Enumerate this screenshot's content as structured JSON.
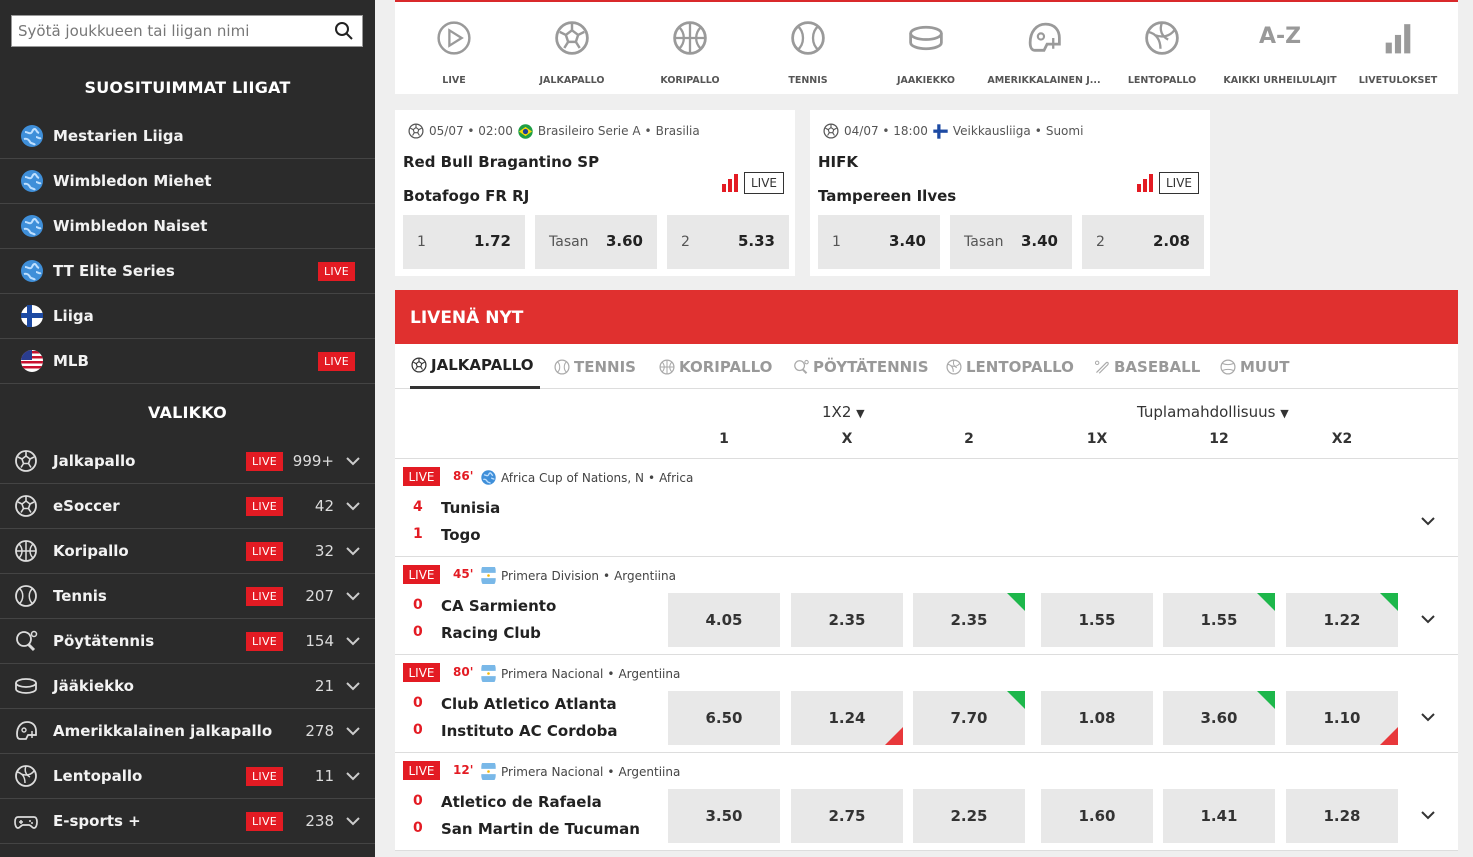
{
  "search": {
    "placeholder": "Syötä joukkueen tai liigan nimi"
  },
  "popular": {
    "title": "SUOSITUIMMAT LIIGAT",
    "items": [
      {
        "label": "Mestarien Liiga",
        "icon": "globe-icon",
        "live": ""
      },
      {
        "label": "Wimbledon Miehet",
        "icon": "globe-icon",
        "live": ""
      },
      {
        "label": "Wimbledon Naiset",
        "icon": "globe-icon",
        "live": ""
      },
      {
        "label": "TT Elite Series",
        "icon": "globe-icon",
        "live": "LIVE"
      },
      {
        "label": "Liiga",
        "icon": "finland-flag-icon",
        "live": ""
      },
      {
        "label": "MLB",
        "icon": "usa-flag-icon",
        "live": "LIVE"
      }
    ]
  },
  "menu": {
    "title": "VALIKKO",
    "items": [
      {
        "label": "Jalkapallo",
        "icon": "soccer-ball-icon",
        "live": "LIVE",
        "count": "999+"
      },
      {
        "label": "eSoccer",
        "icon": "soccer-ball-icon",
        "live": "LIVE",
        "count": "42"
      },
      {
        "label": "Koripallo",
        "icon": "basketball-icon",
        "live": "LIVE",
        "count": "32"
      },
      {
        "label": "Tennis",
        "icon": "tennis-ball-icon",
        "live": "LIVE",
        "count": "207"
      },
      {
        "label": "Pöytätennis",
        "icon": "table-tennis-icon",
        "live": "LIVE",
        "count": "154"
      },
      {
        "label": "Jääkiekko",
        "icon": "hockey-puck-icon",
        "live": "",
        "count": "21"
      },
      {
        "label": "Amerikkalainen jalkapallo",
        "icon": "football-helmet-icon",
        "live": "",
        "count": "278"
      },
      {
        "label": "Lentopallo",
        "icon": "volleyball-icon",
        "live": "LIVE",
        "count": "11"
      },
      {
        "label": "E-sports +",
        "icon": "gamepad-icon",
        "live": "LIVE",
        "count": "238"
      }
    ]
  },
  "sports": [
    {
      "label": "LIVE",
      "icon": "play-circle-icon"
    },
    {
      "label": "JALKAPALLO",
      "icon": "soccer-ball-icon"
    },
    {
      "label": "KORIPALLO",
      "icon": "basketball-icon"
    },
    {
      "label": "TENNIS",
      "icon": "tennis-ball-icon"
    },
    {
      "label": "JÄÄKIEKKO",
      "icon": "hockey-puck-icon"
    },
    {
      "label": "AMERIKKALAINEN J...",
      "icon": "football-helmet-icon"
    },
    {
      "label": "LENTOPALLO",
      "icon": "volleyball-icon"
    },
    {
      "label": "KAIKKI URHEILULAJIT",
      "icon": "az-icon"
    },
    {
      "label": "LIVETULOKSET",
      "icon": "bar-chart-icon"
    }
  ],
  "az_glyph": "A-Z",
  "cards": [
    {
      "date": "05/07 • 02:00",
      "league": "Brasileiro Serie A",
      "country": "Brasilia",
      "flag": "brazil-flag-icon",
      "team1": "Red Bull Bragantino SP",
      "team2": "Botafogo FR RJ",
      "live": "LIVE",
      "odds": [
        {
          "label": "1",
          "value": "1.72"
        },
        {
          "label": "Tasan",
          "value": "3.60"
        },
        {
          "label": "2",
          "value": "5.33"
        }
      ]
    },
    {
      "date": "04/07 • 18:00",
      "league": "Veikkausliiga",
      "country": "Suomi",
      "flag": "finland-flag-icon",
      "team1": "HIFK",
      "team2": "Tampereen Ilves",
      "live": "LIVE",
      "odds": [
        {
          "label": "1",
          "value": "3.40"
        },
        {
          "label": "Tasan",
          "value": "3.40"
        },
        {
          "label": "2",
          "value": "2.08"
        }
      ]
    }
  ],
  "live_now": {
    "title": "LIVENÄ NYT",
    "tabs": [
      {
        "label": "JALKAPALLO",
        "icon": "soccer-ball-icon",
        "active": true
      },
      {
        "label": "TENNIS",
        "icon": "tennis-ball-icon",
        "active": false
      },
      {
        "label": "KORIPALLO",
        "icon": "basketball-icon",
        "active": false
      },
      {
        "label": "PÖYTÄTENNIS",
        "icon": "table-tennis-icon",
        "active": false
      },
      {
        "label": "LENTOPALLO",
        "icon": "volleyball-icon",
        "active": false
      },
      {
        "label": "BASEBALL",
        "icon": "baseball-bat-icon",
        "active": false
      },
      {
        "label": "MUUT",
        "icon": "other-sports-icon",
        "active": false
      }
    ],
    "market1": "1X2",
    "market2": "Tuplamahdollisuus",
    "cols": [
      "1",
      "X",
      "2",
      "1X",
      "12",
      "X2"
    ],
    "matches": [
      {
        "live": "LIVE",
        "minute": "86'",
        "league": "Africa Cup of Nations, N",
        "country": "Africa",
        "flag": "globe-icon",
        "score1": "4",
        "team1": "Tunisia",
        "score2": "1",
        "team2": "Togo",
        "odds": []
      },
      {
        "live": "LIVE",
        "minute": "45'",
        "league": "Primera Division",
        "country": "Argentiina",
        "flag": "argentina-flag-icon",
        "score1": "0",
        "team1": "CA Sarmiento",
        "score2": "0",
        "team2": "Racing Club",
        "odds": [
          {
            "value": "4.05",
            "trend": ""
          },
          {
            "value": "2.35",
            "trend": ""
          },
          {
            "value": "2.35",
            "trend": "up"
          },
          {
            "value": "1.55",
            "trend": ""
          },
          {
            "value": "1.55",
            "trend": "up"
          },
          {
            "value": "1.22",
            "trend": "up"
          }
        ]
      },
      {
        "live": "LIVE",
        "minute": "80'",
        "league": "Primera Nacional",
        "country": "Argentiina",
        "flag": "argentina-flag-icon",
        "score1": "0",
        "team1": "Club Atletico Atlanta",
        "score2": "0",
        "team2": "Instituto AC Cordoba",
        "odds": [
          {
            "value": "6.50",
            "trend": ""
          },
          {
            "value": "1.24",
            "trend": "down"
          },
          {
            "value": "7.70",
            "trend": "up"
          },
          {
            "value": "1.08",
            "trend": ""
          },
          {
            "value": "3.60",
            "trend": "up"
          },
          {
            "value": "1.10",
            "trend": "down"
          }
        ]
      },
      {
        "live": "LIVE",
        "minute": "12'",
        "league": "Primera Nacional",
        "country": "Argentiina",
        "flag": "argentina-flag-icon",
        "score1": "0",
        "team1": "Atletico de Rafaela",
        "score2": "0",
        "team2": "San Martin de Tucuman",
        "odds": [
          {
            "value": "3.50",
            "trend": ""
          },
          {
            "value": "2.75",
            "trend": ""
          },
          {
            "value": "2.25",
            "trend": ""
          },
          {
            "value": "1.60",
            "trend": ""
          },
          {
            "value": "1.41",
            "trend": ""
          },
          {
            "value": "1.28",
            "trend": ""
          }
        ]
      }
    ]
  },
  "colors": {
    "brand_red": "#e0302f",
    "live_red": "#e31b23",
    "sidebar_bg": "#2b2b2b",
    "odds_up": "#1db74b",
    "odds_down": "#e8383b"
  }
}
